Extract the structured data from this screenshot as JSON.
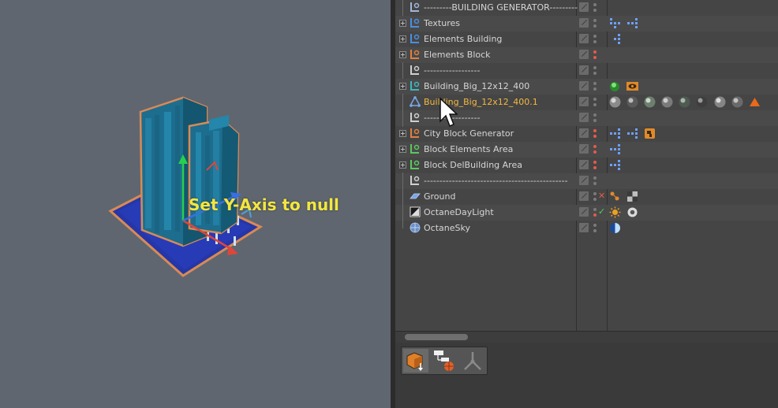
{
  "viewport": {
    "caption": "Set Y-Axis to null"
  },
  "object_manager": {
    "rows": [
      {
        "name": "---------BUILDING GENERATOR---------",
        "icon": "null-object-icon",
        "icon_color": "#9fb7d8",
        "expander": false
      },
      {
        "name": "Textures",
        "icon": "null-object-icon",
        "icon_color": "#4a8fe0",
        "expander": true
      },
      {
        "name": "Elements Building",
        "icon": "null-object-icon",
        "icon_color": "#4a8fe0",
        "expander": true
      },
      {
        "name": "Elements Block",
        "icon": "null-object-icon",
        "icon_color": "#e08040",
        "expander": true
      },
      {
        "name": "------------------",
        "icon": "null-object-icon",
        "icon_color": "#cfcfcf",
        "expander": false
      },
      {
        "name": "Building_Big_12x12_400",
        "icon": "null-object-icon",
        "icon_color": "#3fb6c0",
        "expander": true
      },
      {
        "name": "Building_Big_12x12_400.1",
        "icon": "polygon-object-icon",
        "icon_color": "#7aa6e8",
        "expander": false,
        "selected": true
      },
      {
        "name": "------------------",
        "icon": "null-object-icon",
        "icon_color": "#cfcfcf",
        "expander": false
      },
      {
        "name": "City Block Generator",
        "icon": "null-object-icon",
        "icon_color": "#e08040",
        "expander": true
      },
      {
        "name": "Block Elements Area",
        "icon": "null-object-icon",
        "icon_color": "#5cc85c",
        "expander": true
      },
      {
        "name": "Block DelBuilding Area",
        "icon": "null-object-icon",
        "icon_color": "#5cc85c",
        "expander": true
      },
      {
        "name": "----------------------------------------------",
        "icon": "null-object-icon",
        "icon_color": "#cfcfcf",
        "expander": false
      },
      {
        "name": "Ground",
        "icon": "plane-object-icon",
        "icon_color": "#7aa6e8",
        "expander": false
      },
      {
        "name": "OctaneDayLight",
        "icon": "daylight-object-icon",
        "icon_color": "#dddddd",
        "expander": false
      },
      {
        "name": "OctaneSky",
        "icon": "sky-object-icon",
        "icon_color": "#7aa6e8",
        "expander": false
      }
    ],
    "status_marks": {
      "ground": "✕",
      "daylight": "✓"
    },
    "colors": {
      "selected_text": "#f5b940",
      "caption": "#f2e640",
      "cursor": "#ffffff"
    }
  }
}
